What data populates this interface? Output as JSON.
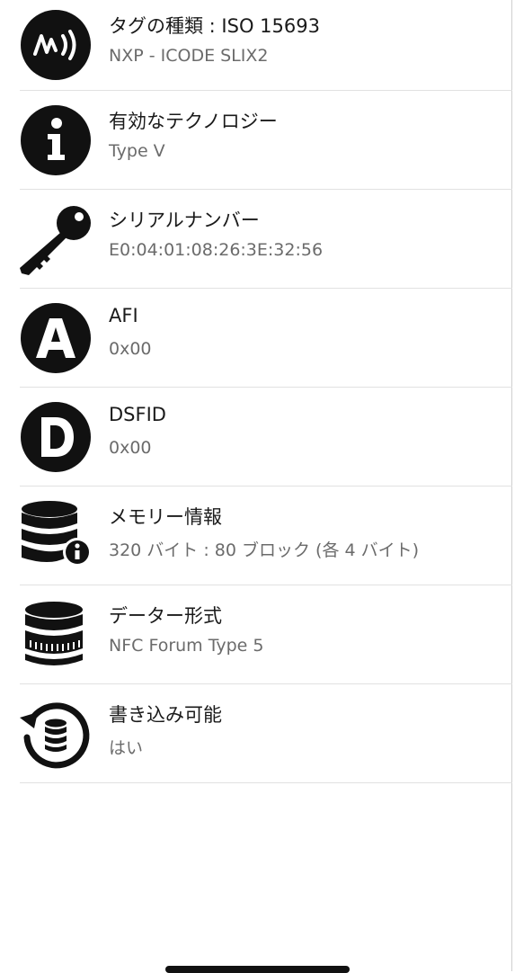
{
  "rows": [
    {
      "icon": "nfc-tag-icon",
      "title": "タグの種類 : ISO 15693",
      "value": "NXP - ICODE SLIX2"
    },
    {
      "icon": "info-icon",
      "title": "有効なテクノロジー",
      "value": "Type V"
    },
    {
      "icon": "key-icon",
      "title": "シリアルナンバー",
      "value": "E0:04:01:08:26:3E:32:56"
    },
    {
      "icon": "letter-a-icon",
      "title": "AFI",
      "value": "0x00"
    },
    {
      "icon": "letter-d-icon",
      "title": "DSFID",
      "value": "0x00"
    },
    {
      "icon": "database-info-icon",
      "title": "メモリー情報",
      "value": "320 バイト : 80 ブロック (各 4 バイト)"
    },
    {
      "icon": "database-format-icon",
      "title": "データー形式",
      "value": "NFC Forum Type 5"
    },
    {
      "icon": "writable-database-icon",
      "title": "書き込み可能",
      "value": "はい"
    }
  ],
  "colors": {
    "icon": "#111111",
    "divider": "#e1e1e1",
    "subtitle": "#6b6b6b"
  }
}
